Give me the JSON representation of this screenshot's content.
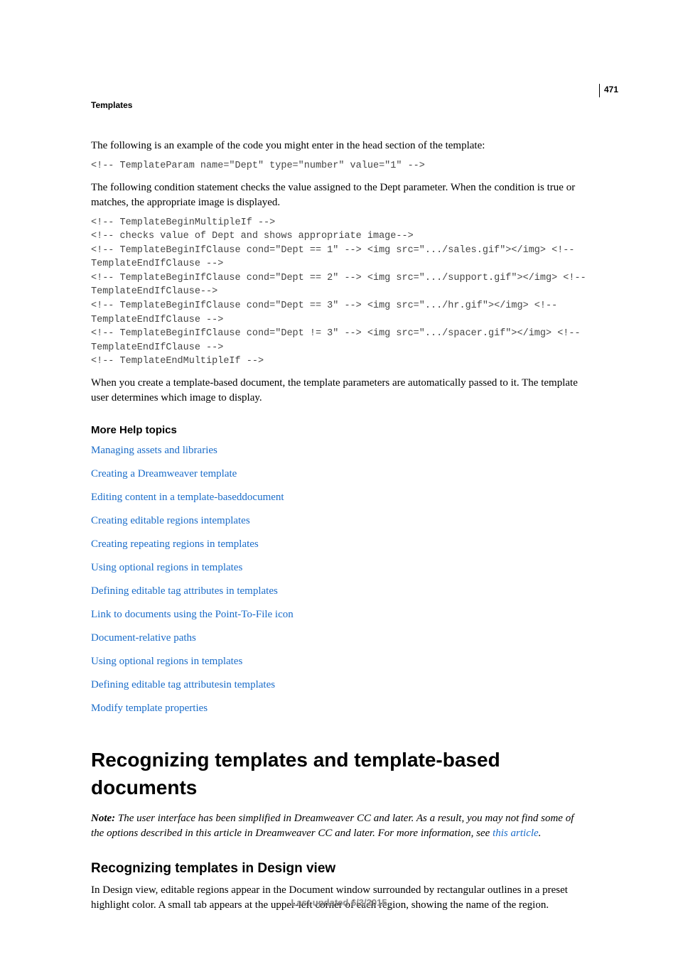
{
  "page_number": "471",
  "header_label": "Templates",
  "intro1": "The following is an example of the code you might enter in the head section of the template:",
  "code1": "<!-- TemplateParam name=\"Dept\" type=\"number\" value=\"1\" -->",
  "intro2": "The following condition statement checks the value assigned to the Dept parameter. When the condition is true or matches, the appropriate image is displayed.",
  "code2": "<!-- TemplateBeginMultipleIf -->\n<!-- checks value of Dept and shows appropriate image-->\n<!-- TemplateBeginIfClause cond=\"Dept == 1\" --> <img src=\".../sales.gif\"></img> <!-- TemplateEndIfClause -->\n<!-- TemplateBeginIfClause cond=\"Dept == 2\" --> <img src=\".../support.gif\"></img> <!-- TemplateEndIfClause-->\n<!-- TemplateBeginIfClause cond=\"Dept == 3\" --> <img src=\".../hr.gif\"></img> <!-- TemplateEndIfClause -->\n<!-- TemplateBeginIfClause cond=\"Dept != 3\" --> <img src=\".../spacer.gif\"></img> <!-- TemplateEndIfClause -->\n<!-- TemplateEndMultipleIf -->",
  "outro1": "When you create a template-based document, the template parameters are automatically passed to it. The template user determines which image to display.",
  "help_heading": "More Help topics",
  "links": [
    "Managing assets and libraries",
    "Creating a Dreamweaver template",
    "Editing content in a template-baseddocument",
    "Creating editable regions intemplates",
    "Creating repeating regions in templates",
    "Using optional regions in templates",
    "Defining editable tag attributes in templates",
    "Link to documents using the Point-To-File icon",
    "Document-relative paths",
    "Using optional regions in templates",
    "Defining editable tag attributesin templates",
    "Modify template properties"
  ],
  "section_title": "Recognizing templates and template-based documents",
  "note_label": "Note:",
  "note_pre": " The user interface has been simplified in Dreamweaver CC and later. As a result, you may not find some of the options described in this article in Dreamweaver CC and later. For more information, see ",
  "note_link": "this article",
  "note_post": ".",
  "subheading": "Recognizing templates in Design view",
  "sub_body": "In Design view, editable regions appear in the Document window surrounded by rectangular outlines in a preset highlight color. A small tab appears at the upper-left corner of each region, showing the name of the region.",
  "footer": "Last updated 6/3/2015"
}
